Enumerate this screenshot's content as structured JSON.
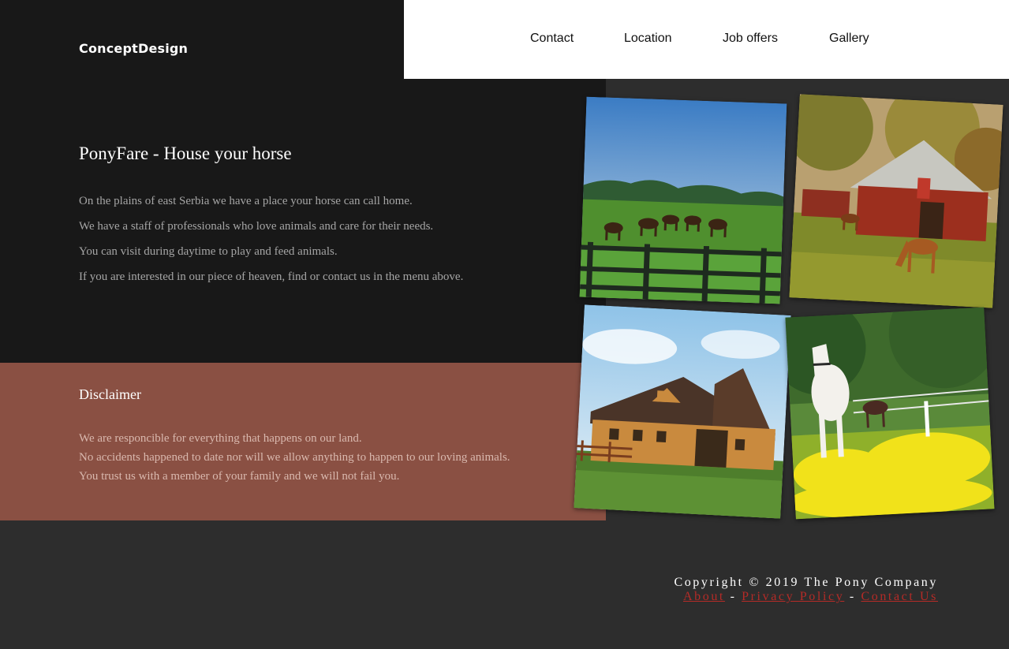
{
  "header": {
    "logo": "ConceptDesign",
    "nav": [
      {
        "label": "Contact"
      },
      {
        "label": "Location"
      },
      {
        "label": "Job offers"
      },
      {
        "label": "Gallery"
      }
    ]
  },
  "hero": {
    "title": "PonyFare - House your horse",
    "lines": [
      "On the plains of east Serbia we have a place your horse can call home.",
      "We have a staff of professionals who love animals and care for their needs.",
      "You can visit during daytime to play and feed animals.",
      "If you are interested in our piece of heaven, find or contact us in the menu above."
    ]
  },
  "disclaimer": {
    "title": "Disclaimer",
    "lines": [
      "We are responcible for everything that happens on our land.",
      "No accidents happened to date nor will we allow anything to happen to our loving animals.",
      "You trust us with a member of your family and we will not fail you."
    ]
  },
  "gallery": {
    "photos": [
      {
        "subject": "horses-grazing-behind-fence"
      },
      {
        "subject": "horse-near-red-barn"
      },
      {
        "subject": "wooden-barn"
      },
      {
        "subject": "white-horse-in-yellow-flowers"
      }
    ]
  },
  "footer": {
    "copyright": "Copyright © 2019 The Pony Company",
    "links": [
      {
        "label": "About"
      },
      {
        "label": "Privacy Policy"
      },
      {
        "label": "Contact Us"
      }
    ],
    "separator": "-"
  },
  "colors": {
    "dark_panel": "#181818",
    "page_bg": "#2d2d2d",
    "disclaimer_bg": "#8a5043",
    "link": "#b52b27"
  }
}
